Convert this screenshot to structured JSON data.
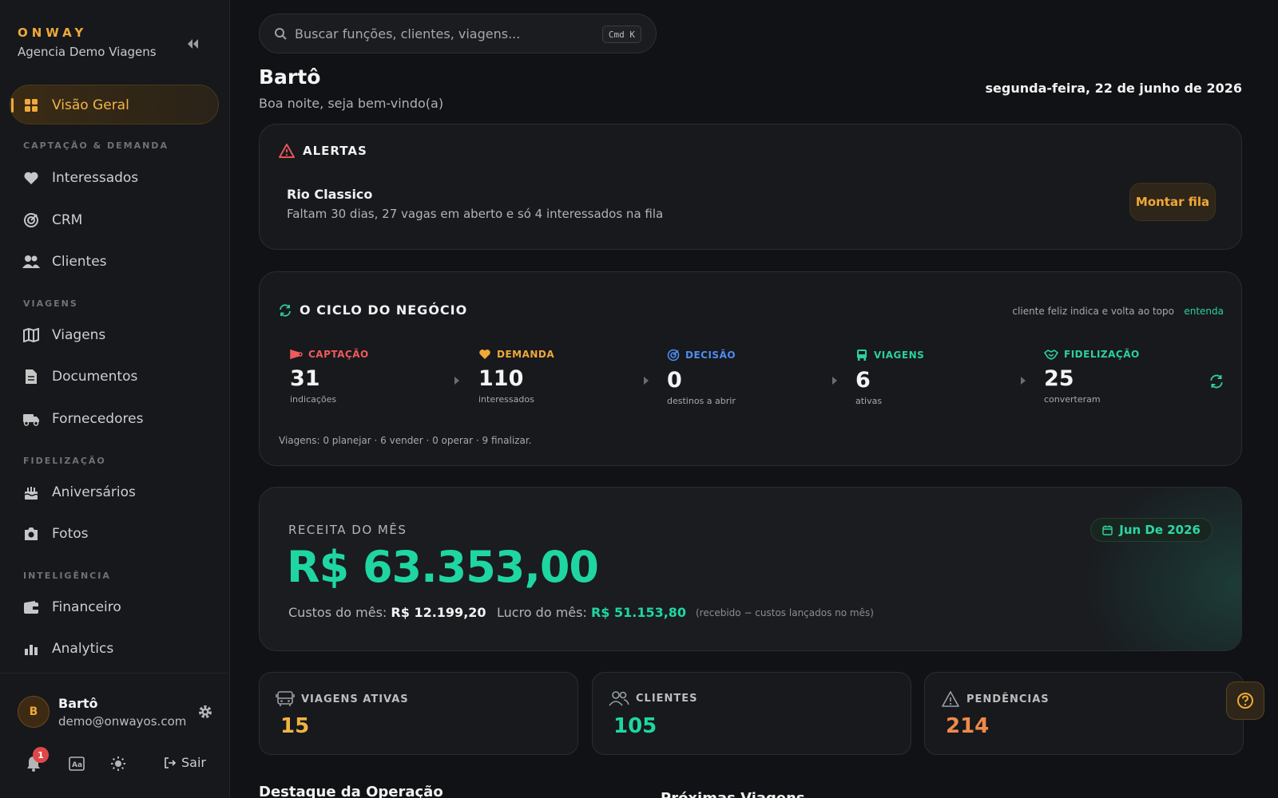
{
  "brand": {
    "name": "ONWAY",
    "agency": "Agencia Demo Viagens"
  },
  "sidebar": {
    "active": "Visão Geral",
    "sections": {
      "captacao": "CAPTAÇÃO & DEMANDA",
      "viagens": "VIAGENS",
      "fidelizacao": "FIDELIZAÇÃO",
      "inteligencia": "INTELIGÊNCIA"
    },
    "items": {
      "visao_geral": "Visão Geral",
      "interessados": "Interessados",
      "crm": "CRM",
      "clientes": "Clientes",
      "viagens": "Viagens",
      "documentos": "Documentos",
      "fornecedores": "Fornecedores",
      "aniversarios": "Aniversários",
      "fotos": "Fotos",
      "financeiro": "Financeiro",
      "analytics": "Analytics"
    },
    "user": {
      "initial": "B",
      "name": "Bartô",
      "email": "demo@onwayos.com"
    },
    "notifications_count": "1",
    "logout_label": "Sair"
  },
  "search": {
    "placeholder": "Buscar funções, clientes, viagens...",
    "shortcut": "Cmd K"
  },
  "header": {
    "name": "Bartô",
    "greeting": "Boa noite, seja bem-vindo(a)",
    "date": "segunda-feira, 22 de junho de 2026"
  },
  "alerts": {
    "title": "ALERTAS",
    "item_name": "Rio Classico",
    "item_desc": "Faltam 30 dias, 27 vagas em aberto e só 4 interessados na fila",
    "action": "Montar fila"
  },
  "cycle": {
    "title": "O CICLO DO NEGÓCIO",
    "hint": "cliente feliz indica e volta ao topo",
    "link": "entenda",
    "stages": [
      {
        "label": "CAPTAÇÃO",
        "value": "31",
        "sub": "indicações",
        "color": "#ef5a5a"
      },
      {
        "label": "DEMANDA",
        "value": "110",
        "sub": "interessados",
        "color": "#f0a838"
      },
      {
        "label": "DECISÃO",
        "value": "0",
        "sub": "destinos a abrir",
        "color": "#4f8cf0"
      },
      {
        "label": "VIAGENS",
        "value": "6",
        "sub": "ativas",
        "color": "#2ecfa0"
      },
      {
        "label": "FIDELIZAÇÃO",
        "value": "25",
        "sub": "converteram",
        "color": "#2ecfa0"
      }
    ],
    "footer": "Viagens: 0 planejar · 6 vender · 0 operar · 9 finalizar."
  },
  "revenue": {
    "label": "RECEITA DO MÊS",
    "value": "R$ 63.353,00",
    "month": "Jun De 2026",
    "costs_label": "Custos do mês:",
    "costs_value": "R$ 12.199,20",
    "profit_label": "Lucro do mês:",
    "profit_value": "R$ 51.153,80",
    "note": "(recebido − custos lançados no mês)"
  },
  "stats": [
    {
      "label": "VIAGENS ATIVAS",
      "value": "15",
      "color": "#f0b442"
    },
    {
      "label": "CLIENTES",
      "value": "105",
      "color": "#1fd6a2"
    },
    {
      "label": "PENDÊNCIAS",
      "value": "214",
      "color": "#f08a4a"
    }
  ],
  "bottom": {
    "left_title": "Destaque da Operação",
    "right_title": "Próximas Viagens"
  }
}
